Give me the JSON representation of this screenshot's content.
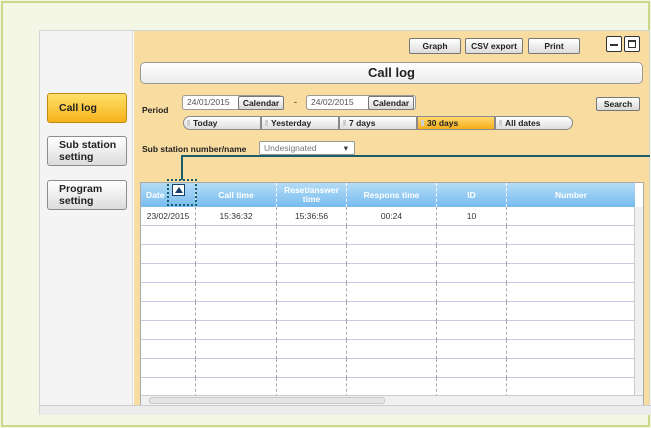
{
  "sidebar": {
    "items": [
      {
        "label": "Call log",
        "active": true
      },
      {
        "label": "Sub station setting",
        "active": false
      },
      {
        "label": "Program setting",
        "active": false
      }
    ]
  },
  "toolbar": {
    "graph_label": "Graph",
    "csv_label": "CSV export",
    "print_label": "Print"
  },
  "page": {
    "title": "Call log"
  },
  "filters": {
    "period_label": "Period",
    "from_date": "24/01/2015",
    "to_date": "24/02/2015",
    "separator": "-",
    "calendar_label": "Calendar",
    "search_label": "Search",
    "ranges": [
      {
        "label": "Today",
        "selected": false
      },
      {
        "label": "Yesterday",
        "selected": false
      },
      {
        "label": "7 days",
        "selected": false
      },
      {
        "label": "30 days",
        "selected": true
      },
      {
        "label": "All dates",
        "selected": false
      }
    ],
    "substation_label": "Sub station number/name",
    "substation_value": "Undesignated",
    "substation_caret": "▾"
  },
  "table": {
    "columns": [
      "Date",
      "Call time",
      "Reset/answer time",
      "Respons time",
      "ID",
      "Number"
    ],
    "rows": [
      [
        "23/02/2015",
        "15:36:32",
        "15:36:56",
        "00:24",
        "10",
        ""
      ]
    ]
  },
  "colors": {
    "accent": "#f6b21a",
    "header": "#77bcee",
    "panel": "#f9dca0",
    "callout": "#1b5e6b"
  },
  "icons": {
    "sort": "sort-ascending-icon"
  }
}
